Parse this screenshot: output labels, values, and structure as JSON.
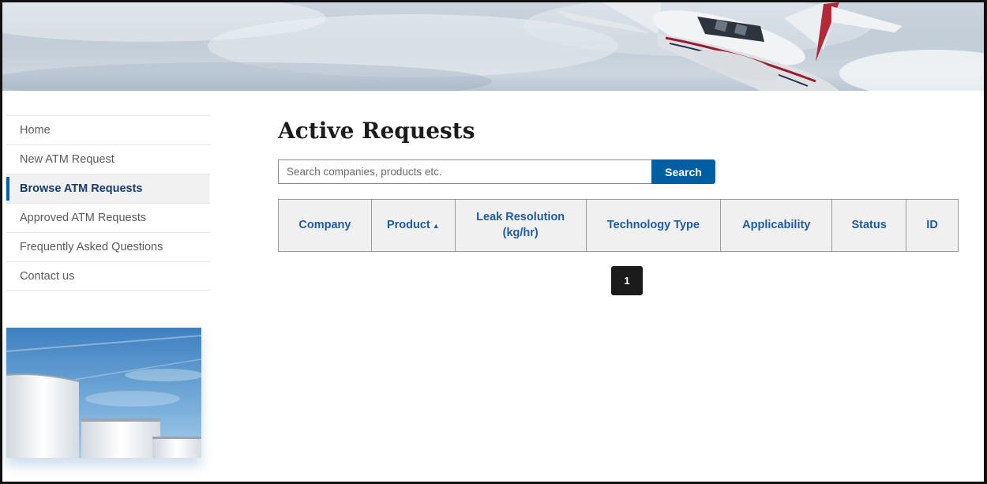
{
  "nav": {
    "items": [
      {
        "label": "Home",
        "active": false
      },
      {
        "label": "New ATM Request",
        "active": false
      },
      {
        "label": "Browse ATM Requests",
        "active": true
      },
      {
        "label": "Approved ATM Requests",
        "active": false
      },
      {
        "label": "Frequently Asked Questions",
        "active": false
      },
      {
        "label": "Contact us",
        "active": false
      }
    ]
  },
  "main": {
    "title": "Active Requests",
    "search": {
      "placeholder": "Search companies, products etc.",
      "value": "",
      "button_label": "Search"
    },
    "table": {
      "columns": [
        {
          "label": "Company",
          "sorted": false
        },
        {
          "label": "Product",
          "sorted": true,
          "sort_direction": "ascending"
        },
        {
          "label": "Leak Resolution\n(kg/hr)",
          "sorted": false
        },
        {
          "label": "Technology Type",
          "sorted": false
        },
        {
          "label": "Applicability",
          "sorted": false
        },
        {
          "label": "Status",
          "sorted": false
        },
        {
          "label": "ID",
          "sorted": false
        }
      ],
      "rows": []
    },
    "pagination": {
      "current_page": "1"
    }
  },
  "images": {
    "banner": "airplane-in-sky",
    "sidebar": "storage-tanks-under-blue-sky"
  },
  "colors": {
    "primary": "#005ea2",
    "link": "#1f5b9e",
    "active_text": "#1a3a6b",
    "pager": "#1b1b1b"
  }
}
